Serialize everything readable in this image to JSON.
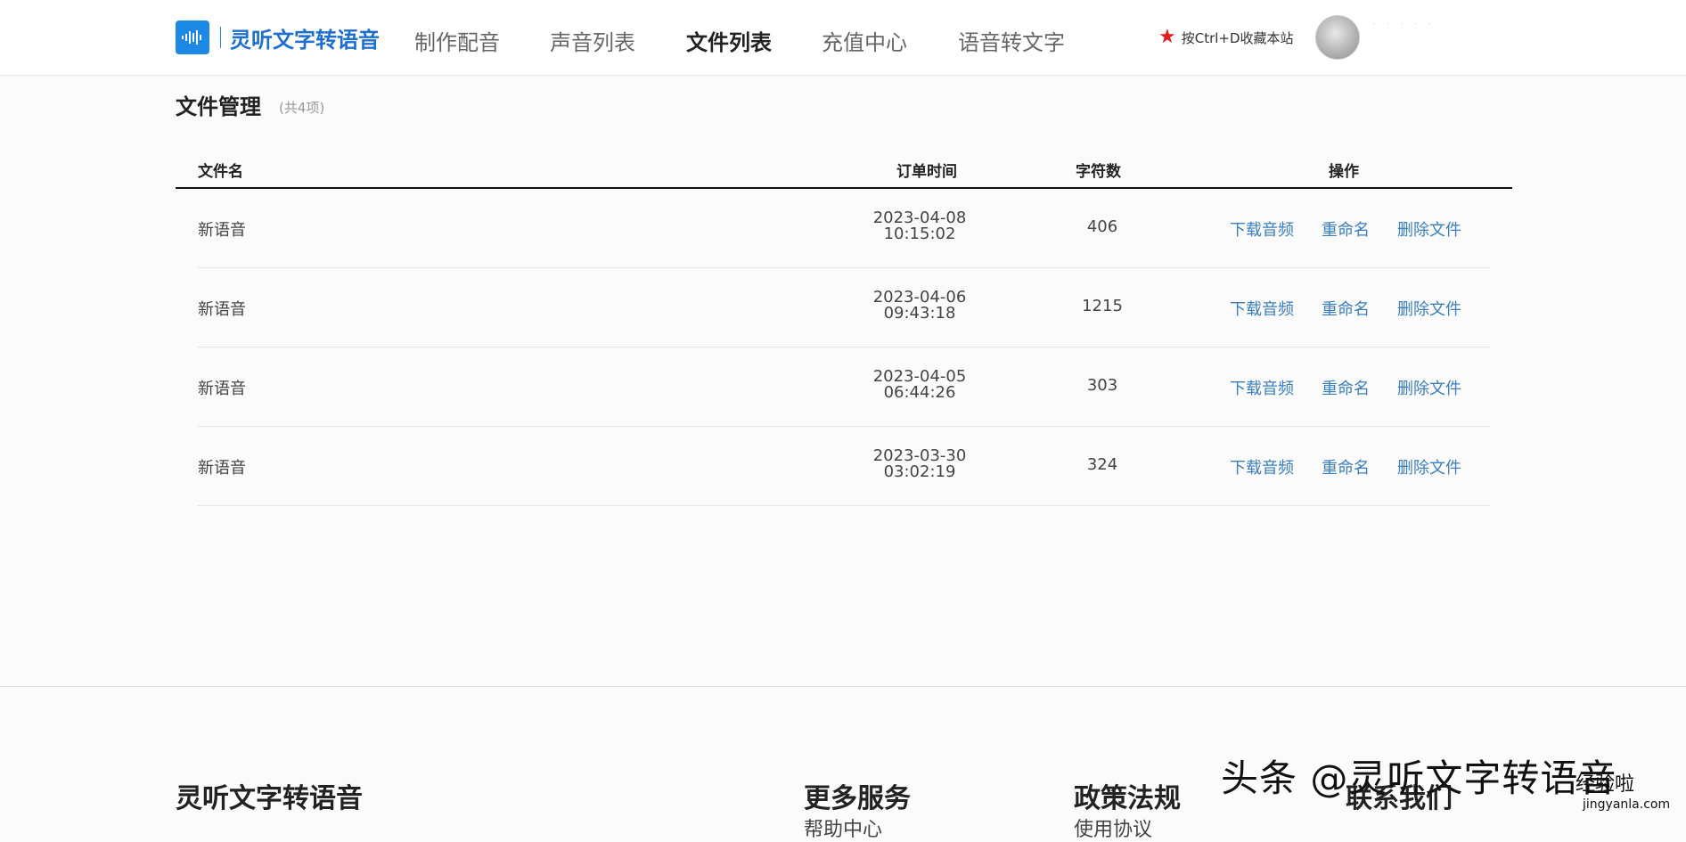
{
  "header": {
    "logo_text": "灵听文字转语音",
    "nav": [
      {
        "label": "制作配音",
        "active": false
      },
      {
        "label": "声音列表",
        "active": false
      },
      {
        "label": "文件列表",
        "active": true
      },
      {
        "label": "充值中心",
        "active": false
      },
      {
        "label": "语音转文字",
        "active": false
      }
    ],
    "bookmark_text": "按Ctrl+D收藏本站",
    "username": "·  ·  ·  ·  ·"
  },
  "page": {
    "title": "文件管理",
    "count": "(共4项)"
  },
  "table": {
    "columns": [
      "文件名",
      "订单时间",
      "字符数",
      "操作"
    ],
    "rows": [
      {
        "name": "新语音",
        "date": "2023-04-08",
        "time": "10:15:02",
        "chars": "406"
      },
      {
        "name": "新语音",
        "date": "2023-04-06",
        "time": "09:43:18",
        "chars": "1215"
      },
      {
        "name": "新语音",
        "date": "2023-04-05",
        "time": "06:44:26",
        "chars": "303"
      },
      {
        "name": "新语音",
        "date": "2023-03-30",
        "time": "03:02:19",
        "chars": "324"
      }
    ],
    "actions": {
      "download": "下载音频",
      "rename": "重命名",
      "delete": "删除文件"
    }
  },
  "footer": {
    "brand": "灵听文字转语音",
    "more_services": "更多服务",
    "more_services_sub": "帮助中心",
    "policy": "政策法规",
    "policy_sub": "使用协议",
    "contact": "联系我们"
  },
  "watermark": {
    "text": "头条 @灵听文字转语音",
    "badge": "经验啦",
    "site": "jingyanla.com"
  },
  "colors": {
    "brand_blue": "#1e6fd0",
    "link_blue": "#3a7fc0",
    "star_red": "#e02020"
  }
}
